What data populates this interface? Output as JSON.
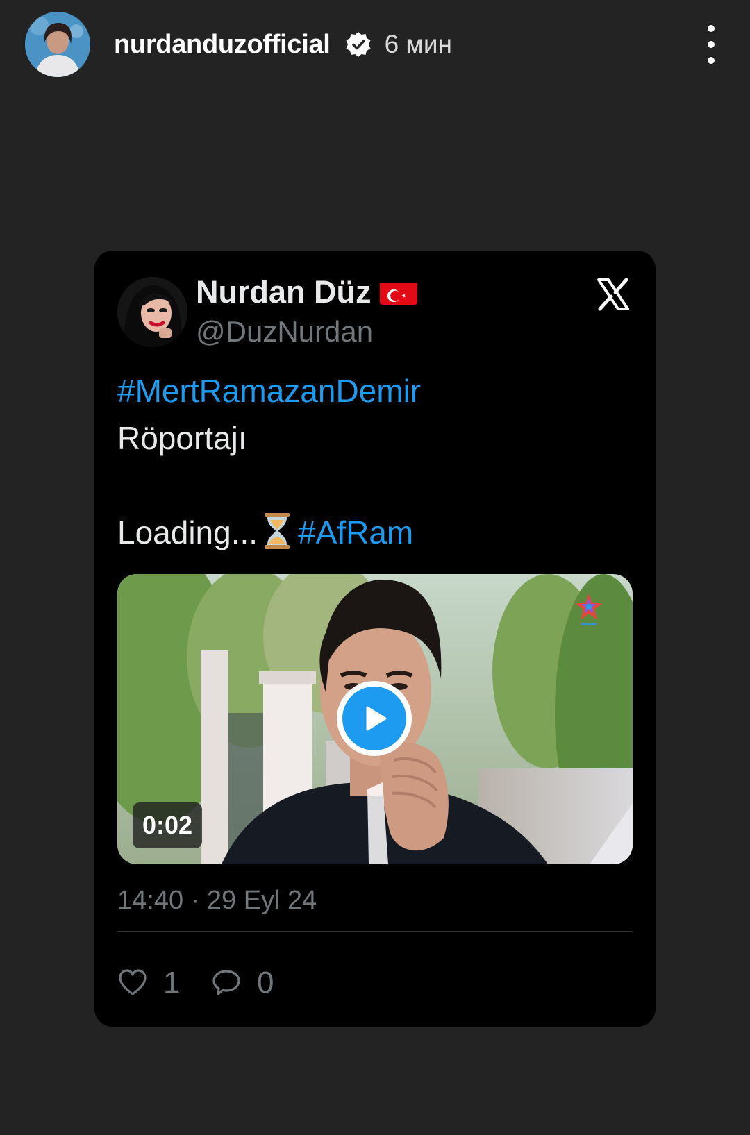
{
  "story": {
    "username": "nurdanduzofficial",
    "time": "6 мин"
  },
  "tweet": {
    "display_name": "Nurdan Düz",
    "handle": "@DuzNurdan",
    "hashtag_1": "#MertRamazanDemir",
    "line_2": "Röportajı",
    "loading_text": "Loading...",
    "hashtag_2": "#AfRam",
    "video_duration": "0:02",
    "timestamp": "14:40 · 29 Eyl 24",
    "like_count": "1",
    "reply_count": "0"
  },
  "colors": {
    "background": "#232323",
    "card": "#000000",
    "hashtag": "#1d9bf0",
    "secondary_text": "#71767b"
  },
  "icons": {
    "verified": "verified-badge-icon",
    "more": "more-vertical-icon",
    "platform": "x-logo-icon",
    "flag": "turkey-flag-icon",
    "emoji": "hourglass-icon",
    "play": "play-icon",
    "like": "heart-icon",
    "reply": "speech-bubble-icon"
  }
}
